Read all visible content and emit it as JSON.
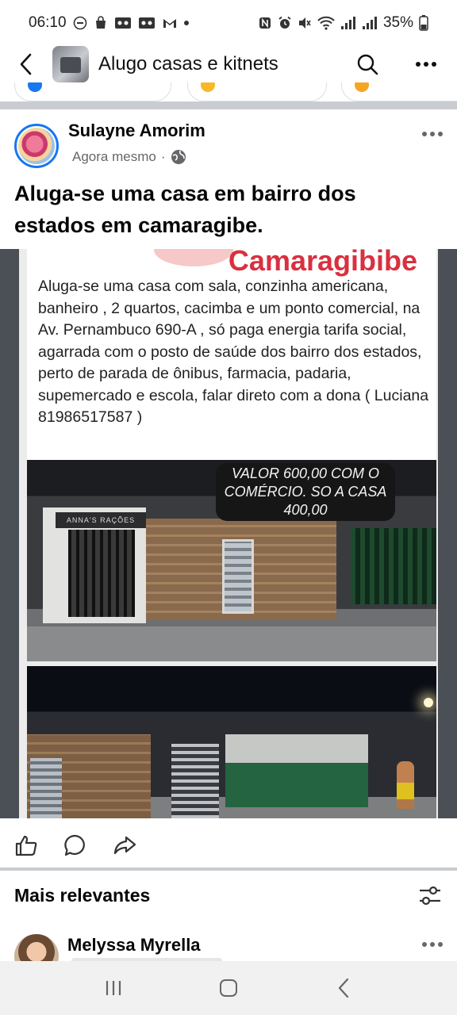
{
  "status_bar": {
    "time": "06:10",
    "battery": "35%",
    "left_icons": [
      "do-not-disturb-icon",
      "bag-icon",
      "voicemail-icon",
      "voicemail-icon",
      "gmail-icon",
      "dot-icon"
    ],
    "right_icons": [
      "nfc-icon",
      "alarm-icon",
      "mute-icon",
      "wifi-icon",
      "signal-icon",
      "signal-icon",
      "battery-icon"
    ]
  },
  "header": {
    "group_name": "Alugo casas e kitnets"
  },
  "post": {
    "author": "Sulayne Amorim",
    "time": "Agora mesmo",
    "separator": "·",
    "privacy_icon": "globe-icon",
    "text": "Aluga-se  uma casa em bairro dos estados em  camaragibe.",
    "image": {
      "flyer_title": "Camaragibibe",
      "flyer_text": "Aluga-se uma casa com sala, conzinha americana, banheiro , 2 quartos, cacimba e um ponto comercial, na Av. Pernambuco 690-A , só paga energia tarifa social, agarrada com o posto de saúde dos bairro dos estados, perto de parada de ônibus, farmacia, padaria, supemercado e escola, falar direto com a dona ( Luciana 81986517587 )",
      "price_tag": "VALOR 600,00 COM O COMÉRCIO. SO A CASA 400,00"
    }
  },
  "actions": {
    "icons": [
      "like-icon",
      "comment-icon",
      "share-icon"
    ]
  },
  "comments": {
    "sort_label": "Mais relevantes",
    "first_comment_author": "Melyssa Myrella"
  }
}
